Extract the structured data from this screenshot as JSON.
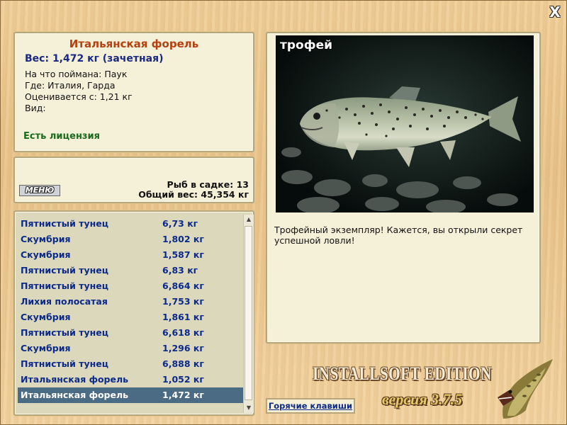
{
  "close_label": "X",
  "info": {
    "title": "Итальянская форель",
    "weight": "Вес: 1,472 кг (зачетная)",
    "caught_with": "На что поймана: Паук",
    "where": "Где: Италия, Гарда",
    "rated_from": "Оценивается с: 1,21 кг",
    "species": "Вид:",
    "license": "Есть лицензия"
  },
  "summary": {
    "menu_label": "МЕНЮ",
    "fish_count": "Рыб в садке: 13",
    "total_weight": "Общий вес: 45,354 кг"
  },
  "fish_list": [
    {
      "name": "Пятнистый тунец",
      "weight": "6,73 кг"
    },
    {
      "name": "Скумбрия",
      "weight": "1,802 кг"
    },
    {
      "name": "Скумбрия",
      "weight": "1,587 кг"
    },
    {
      "name": "Пятнистый тунец",
      "weight": "6,83 кг"
    },
    {
      "name": "Пятнистый тунец",
      "weight": "6,864 кг"
    },
    {
      "name": "Лихия полосатая",
      "weight": "1,753 кг"
    },
    {
      "name": "Скумбрия",
      "weight": "1,861 кг"
    },
    {
      "name": "Пятнистый тунец",
      "weight": "6,618 кг"
    },
    {
      "name": "Скумбрия",
      "weight": "1,296 кг"
    },
    {
      "name": "Пятнистый тунец",
      "weight": "6,888 кг"
    },
    {
      "name": "Итальянская форель",
      "weight": "1,052 кг"
    },
    {
      "name": "Итальянская форель",
      "weight": "1,472 кг"
    }
  ],
  "selected_index": 11,
  "trophy": {
    "label": "трофей",
    "description": "Трофейный экземпляр! Кажется, вы открыли секрет успешной ловли!"
  },
  "hotkeys_label": "Горячие клавиши",
  "brand": {
    "edition": "INSTALLSOFT EDITION",
    "version": "версия 3.7.5"
  },
  "colors": {
    "title": "#b54010",
    "weight": "#1a2a80",
    "license": "#1c6a1c",
    "list_text": "#0c2a8a",
    "selected_row": "#4b6b84"
  }
}
